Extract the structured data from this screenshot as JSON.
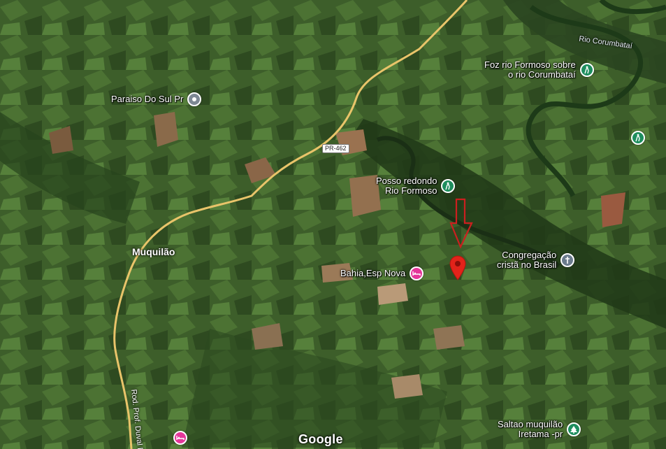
{
  "map": {
    "attribution": "Google",
    "colors": {
      "poi_green": "#1e8e5e",
      "poi_gray": "#6b7b8c",
      "poi_pink": "#e5369a",
      "marker_red": "#e2231a",
      "arrow_red": "#cc1f1f",
      "road": "#e9c46a"
    },
    "pois": [
      {
        "id": "paraiso",
        "label": "Paraiso Do Sul Pr",
        "icon": "place-dot-icon",
        "color": "#7d8894"
      },
      {
        "id": "foz",
        "label_lines": [
          "Foz rio Formoso sobre",
          "o rio Corumbataí"
        ],
        "icon": "hiking-icon",
        "color": "#1e8e5e"
      },
      {
        "id": "posso",
        "label_lines": [
          "Posso redondo",
          "Rio Formoso"
        ],
        "icon": "hiking-icon",
        "color": "#1e8e5e"
      },
      {
        "id": "east-hike",
        "label": "",
        "icon": "hiking-icon",
        "color": "#1e8e5e"
      },
      {
        "id": "congregacao",
        "label_lines": [
          "Congregação",
          "cristã no Brasil"
        ],
        "icon": "church-cross-icon",
        "color": "#6b7b8c"
      },
      {
        "id": "bahia",
        "label": "Bahia,Esp Nova",
        "icon": "hotel-bed-icon",
        "color": "#e5369a"
      },
      {
        "id": "saltao",
        "label_lines": [
          "Saltao muquilão",
          "Iretama -pr"
        ],
        "icon": "park-tree-icon",
        "color": "#1e8e5e"
      },
      {
        "id": "bottom-pink",
        "label": "",
        "icon": "hotel-bed-icon",
        "color": "#e5369a"
      }
    ],
    "towns": {
      "muquilao": "Muquilão"
    },
    "rivers": {
      "corumbatai": "Rio Corumbataí"
    },
    "roads": {
      "shield": "PR-462",
      "name": "Rod. Prof. Duval P"
    }
  }
}
